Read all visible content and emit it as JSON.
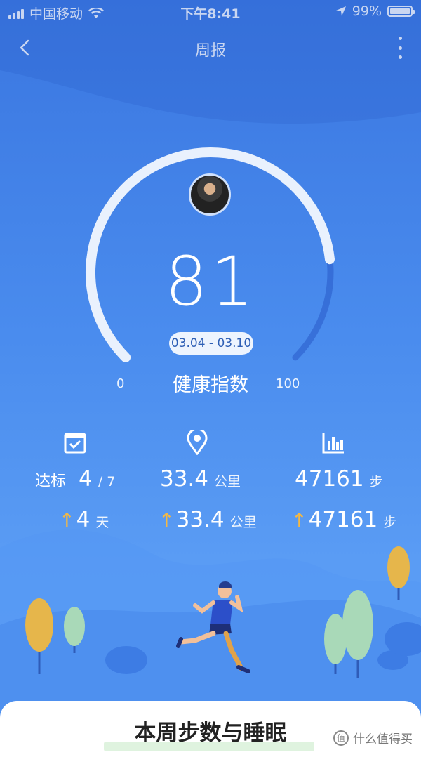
{
  "status_bar": {
    "carrier": "中国移动",
    "time": "下午8:41",
    "battery": "99%",
    "battery_level": 0.99
  },
  "nav": {
    "title": "周报",
    "back_icon": "chevron-left-icon",
    "more_icon": "more-vertical-icon"
  },
  "health": {
    "score": "81",
    "score_value": 81,
    "range_min": "0",
    "range_max": "100",
    "date_range": "03.04 - 03.10",
    "label": "健康指数"
  },
  "stats": {
    "goal": {
      "icon": "calendar-check-icon",
      "label": "达标",
      "value": "4",
      "total": "/ 7",
      "change": "4",
      "change_unit": "天"
    },
    "distance": {
      "icon": "location-pin-icon",
      "value": "33.4",
      "unit": "公里",
      "change": "33.4",
      "change_unit": "公里"
    },
    "steps": {
      "icon": "bar-chart-icon",
      "value": "47161",
      "unit": "步",
      "change": "47161",
      "change_unit": "步"
    }
  },
  "card": {
    "title": "本周步数与睡眠"
  },
  "watermark": {
    "text": "什么值得买",
    "icon": "smzdm-logo-icon"
  },
  "colors": {
    "background": "#4a8cee",
    "accent_arrow": "#f5b841",
    "date_text": "#2e5fb5"
  }
}
